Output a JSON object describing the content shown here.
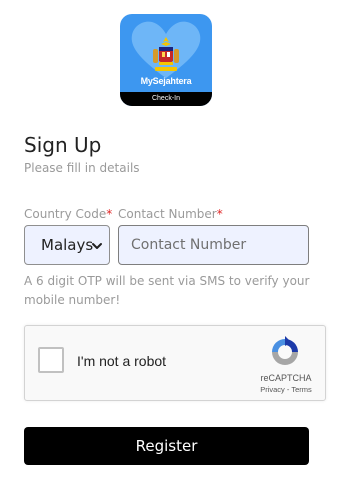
{
  "logo": {
    "app_name": "MySejahtera",
    "band_text": "Check-In"
  },
  "form": {
    "title": "Sign Up",
    "subtitle": "Please fill in details",
    "country_code_label": "Country Code",
    "contact_number_label": "Contact Number",
    "required_marker": "*",
    "country_code_value": "Malaysia",
    "contact_number_placeholder": "Contact Number",
    "contact_number_value": "",
    "otp_note": "A 6 digit OTP will be sent via SMS to verify your mobile number!",
    "register_label": "Register"
  },
  "captcha": {
    "label": "I'm not a robot",
    "brand": "reCAPTCHA",
    "privacy": "Privacy",
    "separator": " - ",
    "terms": "Terms"
  },
  "colors": {
    "logo_bg": "#3d97f0",
    "required": "#e02424",
    "input_bg": "#eef2ff",
    "button_bg": "#000000"
  }
}
